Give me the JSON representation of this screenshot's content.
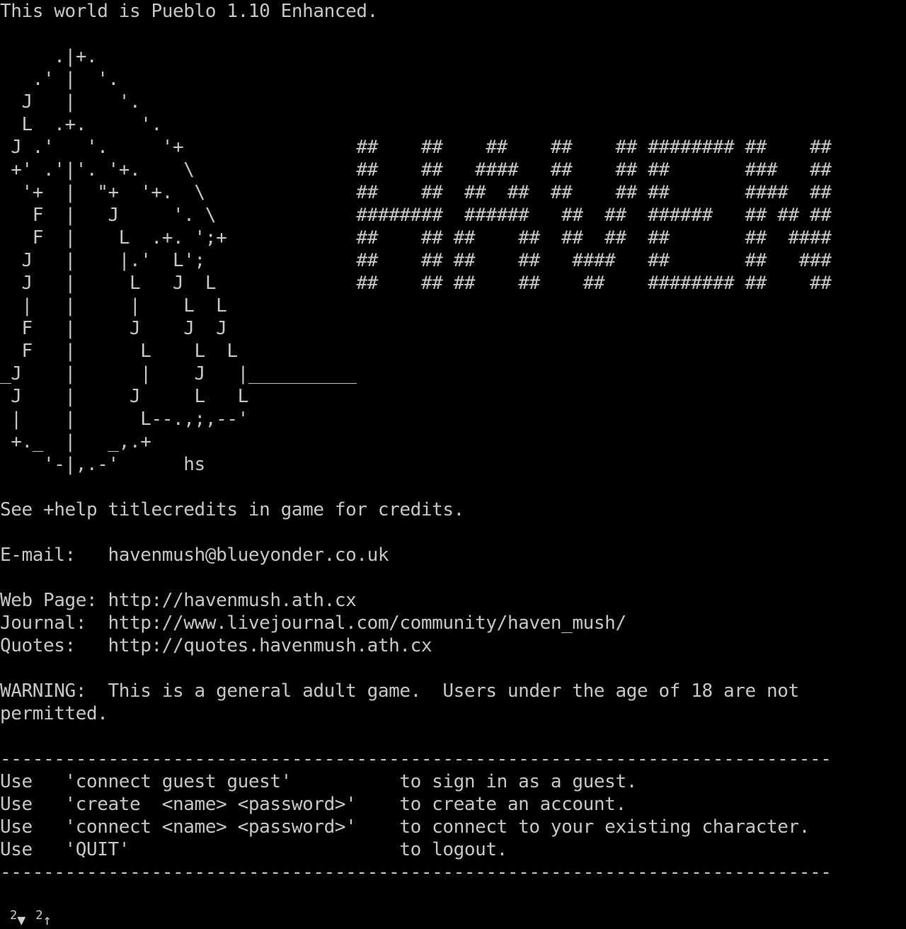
{
  "terminal": {
    "lines": [
      "This world is Pueblo 1.10 Enhanced.",
      "",
      "     .|+.",
      "   .' |  '.",
      "  J   |    '.",
      "  L  .+.     '.",
      " J .'   '.     '+                ##    ##    ##    ##    ## ######## ##    ##",
      " +' .'|'. '+.    \\               ##    ##   ####   ##    ## ##       ###   ##",
      "  '+  |  \"+  '+.  \\              ##    ##  ##  ##  ##    ## ##       ####  ##",
      "   F  |   J     '. \\             ########  ######   ##  ##  ######   ## ## ##",
      "   F  |    L  .+. ';+            ##    ## ##    ##  ##  ##  ##       ##  ####",
      "  J   |    |.'  L';              ##    ## ##    ##   ####   ##       ##   ###",
      "  J   |     L   J  L             ##    ## ##    ##    ##    ######## ##    ##",
      "  |   |     |    L  L",
      "  F   |     J    J  J",
      "  F   |      L    L  L",
      "_J    |      |    J   |__________",
      " J    |     J     L   L",
      " |    |      L--.,;,--'",
      " +._  |   _,.+",
      "    '-|,.-'      hs",
      "",
      "See +help titlecredits in game for credits.",
      "",
      "E-mail:   havenmush@blueyonder.co.uk",
      "",
      "Web Page: http://havenmush.ath.cx",
      "Journal:  http://www.livejournal.com/community/haven_mush/",
      "Quotes:   http://quotes.havenmush.ath.cx",
      "",
      "WARNING:  This is a general adult game.  Users under the age of 18 are not",
      "permitted.",
      "",
      "-----------------------------------------------------------------------------",
      "Use   'connect guest guest'          to sign in as a guest.",
      "Use   'create  <name> <password>'    to create an account.",
      "Use   'connect <name> <password>'    to connect to your existing character.",
      "Use   'QUIT'                         to logout.",
      "-----------------------------------------------------------------------------"
    ]
  },
  "status": {
    "down_count": "2",
    "down_arrow": "▼",
    "up_count": "2",
    "up_arrow": "↑"
  },
  "colors": {
    "background": "#000000",
    "foreground": "#c6c6c6"
  }
}
